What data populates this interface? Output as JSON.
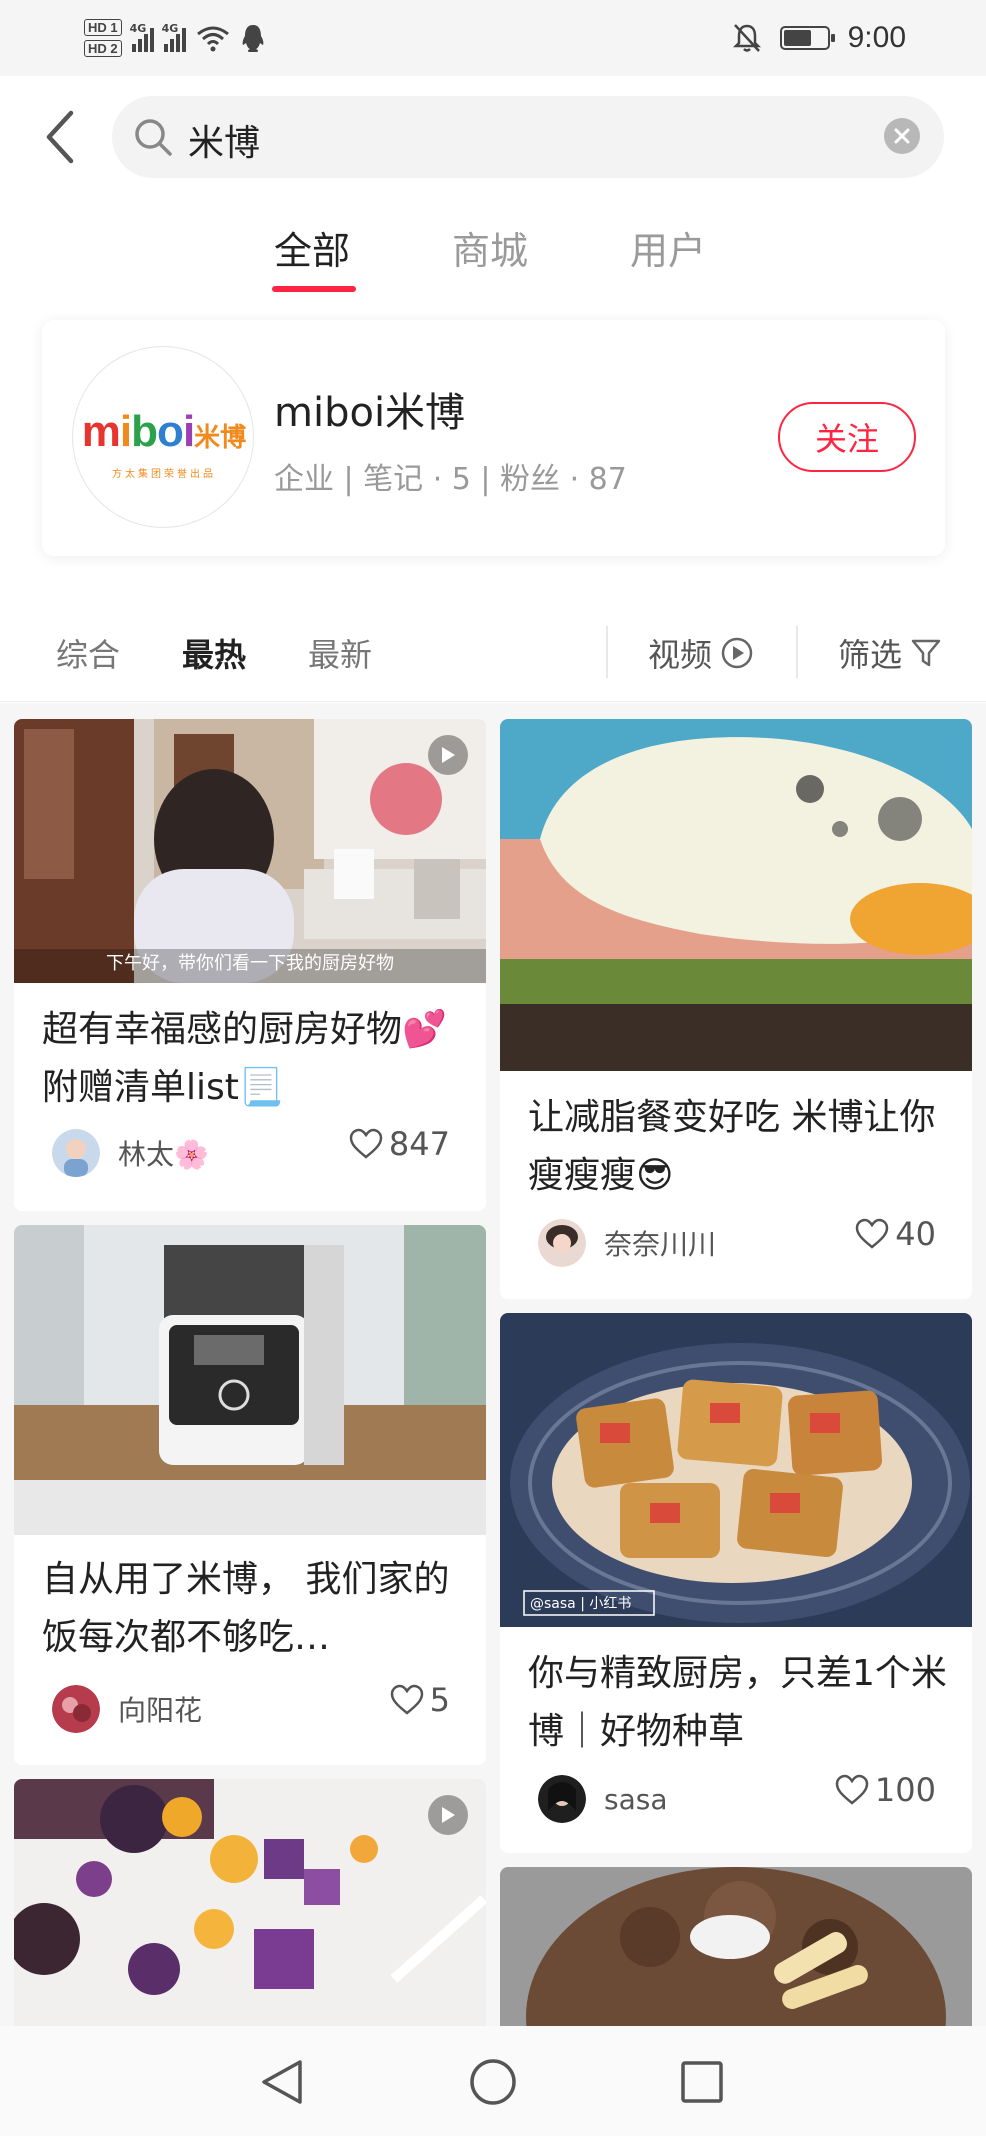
{
  "status_bar": {
    "time": "9:00",
    "network_labels": [
      "4G",
      "4G"
    ],
    "hd_labels": [
      "HD 1",
      "HD 2"
    ],
    "battery_level": 0.6,
    "icons": [
      "hd-icon",
      "signal-icon",
      "wifi-icon",
      "qq-icon",
      "mute-icon",
      "battery-icon"
    ]
  },
  "search": {
    "query": "米博",
    "icons": {
      "back": "chevron-left-icon",
      "search": "search-icon",
      "clear": "close-circle-icon"
    }
  },
  "main_tabs": [
    {
      "label": "全部",
      "active": true
    },
    {
      "label": "商城",
      "active": false
    },
    {
      "label": "用户",
      "active": false
    }
  ],
  "user_card": {
    "logo_text_en": "miboi",
    "logo_text_cn": "米博",
    "logo_subtitle": "方太集团荣誉出品",
    "name": "miboi米博",
    "meta": "企业 | 笔记 · 5 | 粉丝 · 87",
    "follow_label": "关注",
    "logo_colors": [
      "#e8342f",
      "#f08a1c",
      "#2aa14a",
      "#2f7fd0",
      "#9c3fb5"
    ],
    "accent_color": "#ff2442"
  },
  "filter_bar": {
    "tabs": [
      {
        "label": "综合",
        "active": false
      },
      {
        "label": "最热",
        "active": true
      },
      {
        "label": "最新",
        "active": false
      }
    ],
    "video_label": "视频",
    "filter_label": "筛选",
    "icons": {
      "video": "play-circle-icon",
      "filter": "funnel-icon"
    }
  },
  "feed": {
    "left": [
      {
        "title": "超有幸福感的厨房好物💕附赠清单list📃",
        "author": "林太🌸",
        "likes": "847",
        "has_video": true,
        "image_caption": "下午好，带你们看一下我的厨房好物"
      },
      {
        "title": "自从用了米博， 我们家的饭每次都不够吃…",
        "author": "向阳花",
        "likes": "5",
        "has_video": false
      },
      {
        "title": "",
        "author": "",
        "likes": "",
        "has_video": true
      }
    ],
    "right": [
      {
        "title": "让减脂餐变好吃 米博让你瘦瘦瘦😎",
        "author": "奈奈川川",
        "likes": "40",
        "has_video": false
      },
      {
        "title": "你与精致厨房，只差1个米博｜好物种草",
        "author": "sasa",
        "likes": "100",
        "has_video": false,
        "image_watermark": "@sasa | 小红书"
      },
      {
        "title": "",
        "author": "",
        "likes": "",
        "has_video": false
      }
    ]
  },
  "nav_bar": {
    "icons": [
      "nav-back-icon",
      "nav-home-icon",
      "nav-recents-icon"
    ]
  }
}
